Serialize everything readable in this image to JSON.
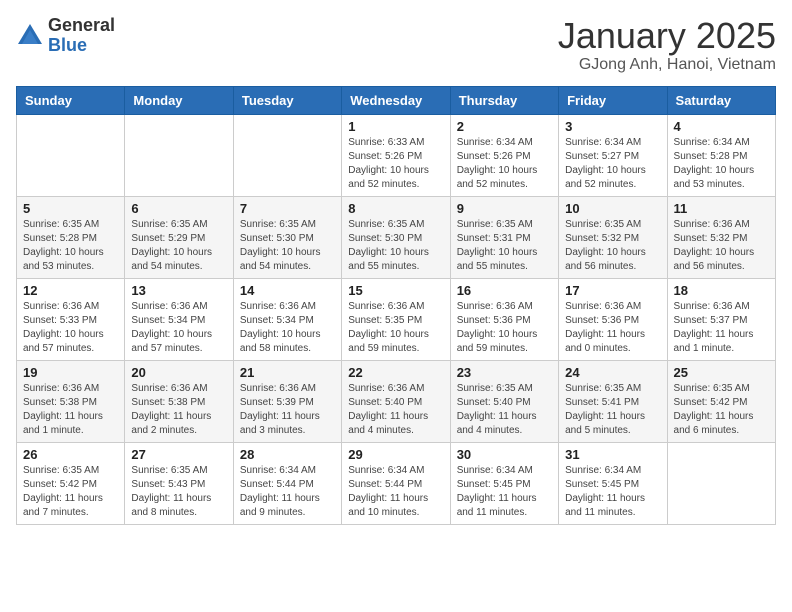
{
  "logo": {
    "general": "General",
    "blue": "Blue"
  },
  "header": {
    "month": "January 2025",
    "location": "GJong Anh, Hanoi, Vietnam"
  },
  "weekdays": [
    "Sunday",
    "Monday",
    "Tuesday",
    "Wednesday",
    "Thursday",
    "Friday",
    "Saturday"
  ],
  "weeks": [
    [
      {
        "day": "",
        "info": ""
      },
      {
        "day": "",
        "info": ""
      },
      {
        "day": "",
        "info": ""
      },
      {
        "day": "1",
        "info": "Sunrise: 6:33 AM\nSunset: 5:26 PM\nDaylight: 10 hours\nand 52 minutes."
      },
      {
        "day": "2",
        "info": "Sunrise: 6:34 AM\nSunset: 5:26 PM\nDaylight: 10 hours\nand 52 minutes."
      },
      {
        "day": "3",
        "info": "Sunrise: 6:34 AM\nSunset: 5:27 PM\nDaylight: 10 hours\nand 52 minutes."
      },
      {
        "day": "4",
        "info": "Sunrise: 6:34 AM\nSunset: 5:28 PM\nDaylight: 10 hours\nand 53 minutes."
      }
    ],
    [
      {
        "day": "5",
        "info": "Sunrise: 6:35 AM\nSunset: 5:28 PM\nDaylight: 10 hours\nand 53 minutes."
      },
      {
        "day": "6",
        "info": "Sunrise: 6:35 AM\nSunset: 5:29 PM\nDaylight: 10 hours\nand 54 minutes."
      },
      {
        "day": "7",
        "info": "Sunrise: 6:35 AM\nSunset: 5:30 PM\nDaylight: 10 hours\nand 54 minutes."
      },
      {
        "day": "8",
        "info": "Sunrise: 6:35 AM\nSunset: 5:30 PM\nDaylight: 10 hours\nand 55 minutes."
      },
      {
        "day": "9",
        "info": "Sunrise: 6:35 AM\nSunset: 5:31 PM\nDaylight: 10 hours\nand 55 minutes."
      },
      {
        "day": "10",
        "info": "Sunrise: 6:35 AM\nSunset: 5:32 PM\nDaylight: 10 hours\nand 56 minutes."
      },
      {
        "day": "11",
        "info": "Sunrise: 6:36 AM\nSunset: 5:32 PM\nDaylight: 10 hours\nand 56 minutes."
      }
    ],
    [
      {
        "day": "12",
        "info": "Sunrise: 6:36 AM\nSunset: 5:33 PM\nDaylight: 10 hours\nand 57 minutes."
      },
      {
        "day": "13",
        "info": "Sunrise: 6:36 AM\nSunset: 5:34 PM\nDaylight: 10 hours\nand 57 minutes."
      },
      {
        "day": "14",
        "info": "Sunrise: 6:36 AM\nSunset: 5:34 PM\nDaylight: 10 hours\nand 58 minutes."
      },
      {
        "day": "15",
        "info": "Sunrise: 6:36 AM\nSunset: 5:35 PM\nDaylight: 10 hours\nand 59 minutes."
      },
      {
        "day": "16",
        "info": "Sunrise: 6:36 AM\nSunset: 5:36 PM\nDaylight: 10 hours\nand 59 minutes."
      },
      {
        "day": "17",
        "info": "Sunrise: 6:36 AM\nSunset: 5:36 PM\nDaylight: 11 hours\nand 0 minutes."
      },
      {
        "day": "18",
        "info": "Sunrise: 6:36 AM\nSunset: 5:37 PM\nDaylight: 11 hours\nand 1 minute."
      }
    ],
    [
      {
        "day": "19",
        "info": "Sunrise: 6:36 AM\nSunset: 5:38 PM\nDaylight: 11 hours\nand 1 minute."
      },
      {
        "day": "20",
        "info": "Sunrise: 6:36 AM\nSunset: 5:38 PM\nDaylight: 11 hours\nand 2 minutes."
      },
      {
        "day": "21",
        "info": "Sunrise: 6:36 AM\nSunset: 5:39 PM\nDaylight: 11 hours\nand 3 minutes."
      },
      {
        "day": "22",
        "info": "Sunrise: 6:36 AM\nSunset: 5:40 PM\nDaylight: 11 hours\nand 4 minutes."
      },
      {
        "day": "23",
        "info": "Sunrise: 6:35 AM\nSunset: 5:40 PM\nDaylight: 11 hours\nand 4 minutes."
      },
      {
        "day": "24",
        "info": "Sunrise: 6:35 AM\nSunset: 5:41 PM\nDaylight: 11 hours\nand 5 minutes."
      },
      {
        "day": "25",
        "info": "Sunrise: 6:35 AM\nSunset: 5:42 PM\nDaylight: 11 hours\nand 6 minutes."
      }
    ],
    [
      {
        "day": "26",
        "info": "Sunrise: 6:35 AM\nSunset: 5:42 PM\nDaylight: 11 hours\nand 7 minutes."
      },
      {
        "day": "27",
        "info": "Sunrise: 6:35 AM\nSunset: 5:43 PM\nDaylight: 11 hours\nand 8 minutes."
      },
      {
        "day": "28",
        "info": "Sunrise: 6:34 AM\nSunset: 5:44 PM\nDaylight: 11 hours\nand 9 minutes."
      },
      {
        "day": "29",
        "info": "Sunrise: 6:34 AM\nSunset: 5:44 PM\nDaylight: 11 hours\nand 10 minutes."
      },
      {
        "day": "30",
        "info": "Sunrise: 6:34 AM\nSunset: 5:45 PM\nDaylight: 11 hours\nand 11 minutes."
      },
      {
        "day": "31",
        "info": "Sunrise: 6:34 AM\nSunset: 5:45 PM\nDaylight: 11 hours\nand 11 minutes."
      },
      {
        "day": "",
        "info": ""
      }
    ]
  ]
}
